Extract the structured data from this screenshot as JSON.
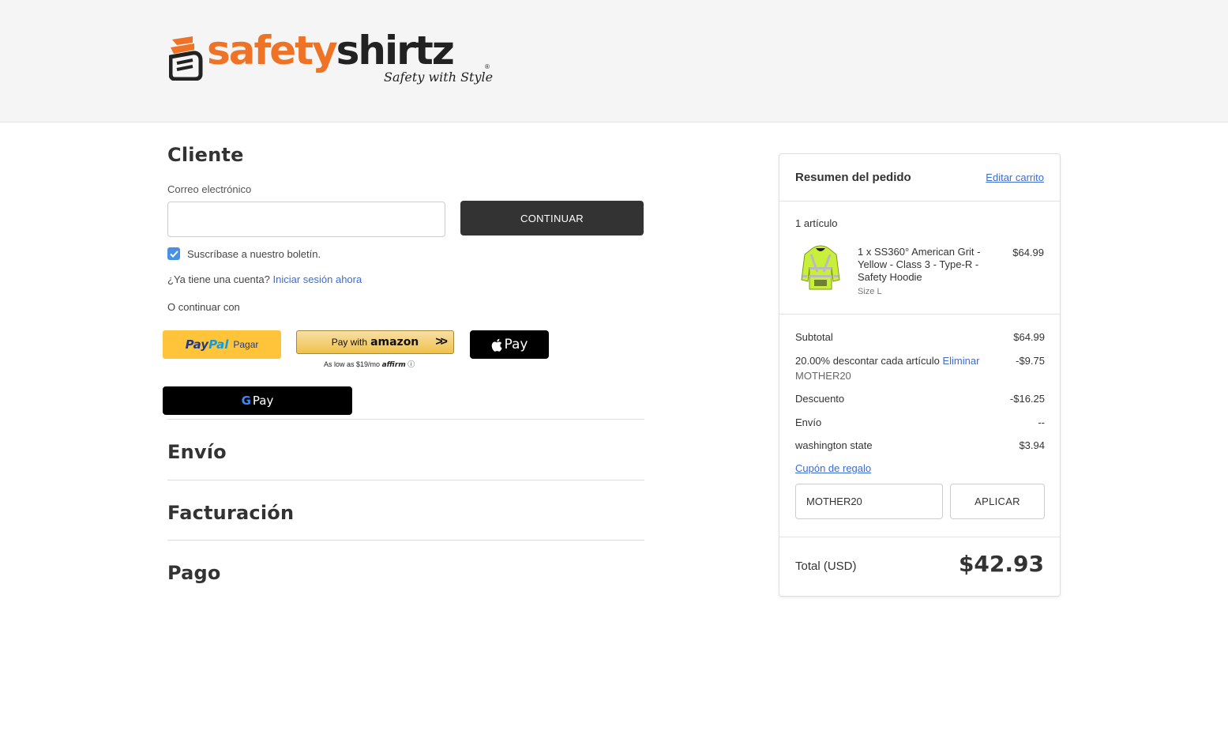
{
  "brand": {
    "word_part1": "safety",
    "word_part2": "shirtz",
    "tagline": "Safety with Style",
    "registered": "®",
    "colors": {
      "orange": "#ee7326",
      "dark": "#222222"
    }
  },
  "customer": {
    "title": "Cliente",
    "email_label": "Correo electrónico",
    "email_value": "",
    "continue_label": "CONTINUAR",
    "newsletter_label": "Suscríbase a nuestro boletín.",
    "newsletter_checked": true,
    "have_account": "¿Ya tiene una cuenta?",
    "sign_in_link": "Iniciar sesión ahora",
    "or_continue": "O continuar con"
  },
  "payment_buttons": {
    "paypal_1": "Pay",
    "paypal_2": "Pal",
    "paypal_action": "Pagar",
    "amazon_prefix": "Pay with",
    "amazon_brand": "amazon",
    "amazon_chevrons": ">>",
    "affirm_text": "As low as $19/mo",
    "affirm_brand": "affirm",
    "affirm_info": "ⓘ",
    "apple_pay": "Pay",
    "google_g": "G",
    "google_pay": "Pay"
  },
  "sections": {
    "shipping": "Envío",
    "billing": "Facturación",
    "payment": "Pago"
  },
  "summary": {
    "title": "Resumen del pedido",
    "edit_cart": "Editar carrito",
    "item_count": "1 artículo",
    "item": {
      "name": "1 x SS360° American Grit - Yellow - Class 3 - Type-R - Safety Hoodie",
      "option": "Size L",
      "price": "$64.99"
    },
    "subtotal_label": "Subtotal",
    "subtotal_value": "$64.99",
    "discount_line_label": "20.00% descontar cada artículo",
    "discount_remove": "Eliminar",
    "discount_line_value": "-$9.75",
    "coupon_code": "MOTHER20",
    "discount_label": "Descuento",
    "discount_value": "-$16.25",
    "shipping_label": "Envío",
    "shipping_value": "--",
    "tax_label": "washington state",
    "tax_value": "$3.94",
    "gift_link": "Cupón de regalo",
    "coupon_input_value": "MOTHER20",
    "apply_label": "APLICAR",
    "total_label": "Total (USD)",
    "total_value": "$42.93"
  }
}
